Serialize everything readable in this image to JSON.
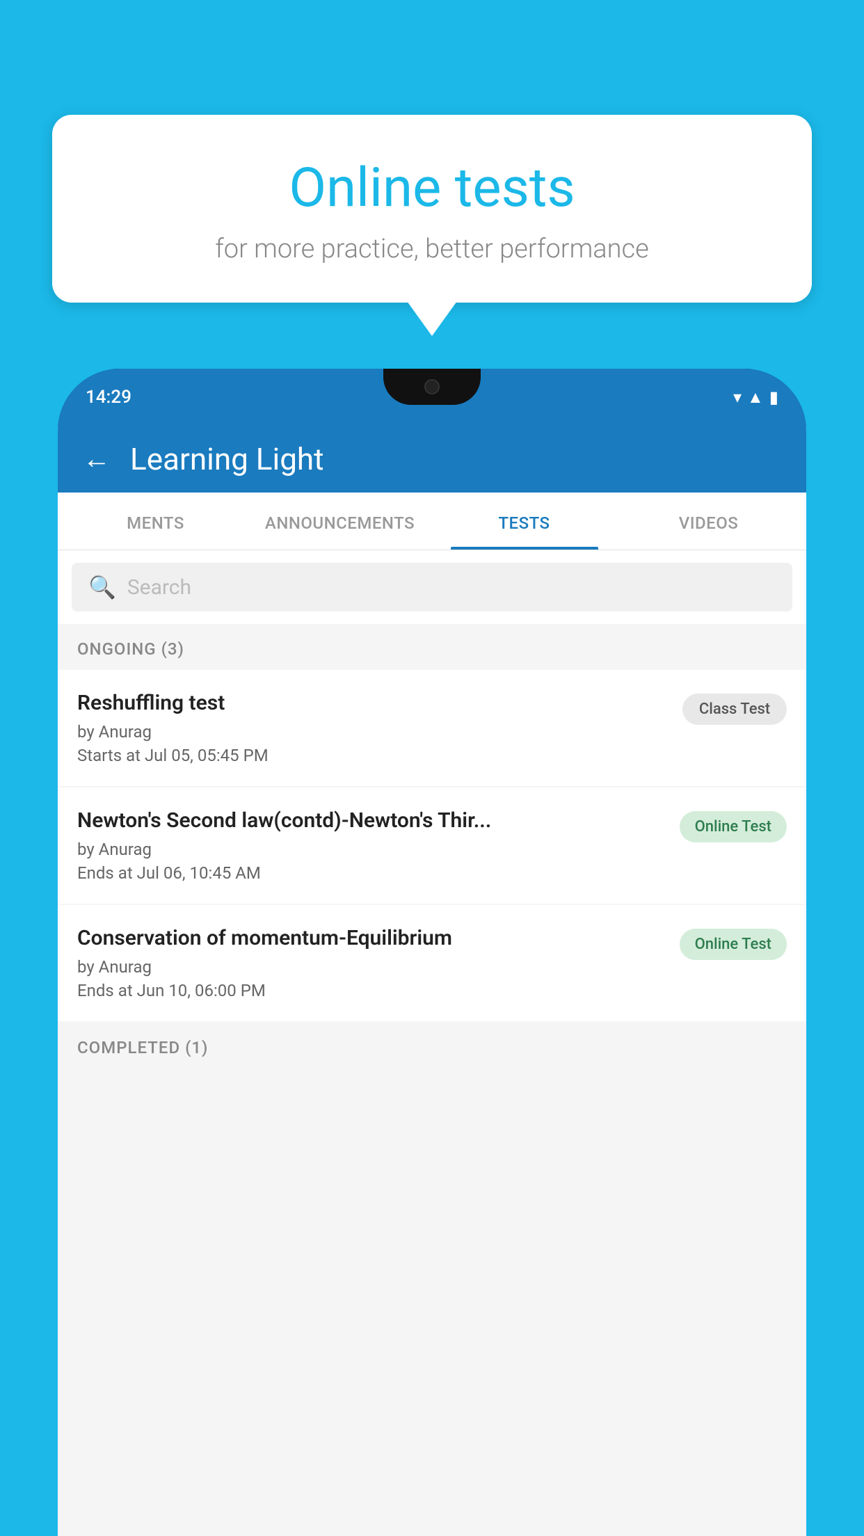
{
  "background_color": "#1bb8e8",
  "bubble": {
    "title": "Online tests",
    "subtitle": "for more practice, better performance"
  },
  "phone": {
    "status_time": "14:29",
    "header": {
      "back_label": "←",
      "title": "Learning Light"
    },
    "tabs": [
      {
        "id": "ments",
        "label": "MENTS",
        "active": false
      },
      {
        "id": "announcements",
        "label": "ANNOUNCEMENTS",
        "active": false
      },
      {
        "id": "tests",
        "label": "TESTS",
        "active": true
      },
      {
        "id": "videos",
        "label": "VIDEOS",
        "active": false
      }
    ],
    "search": {
      "placeholder": "Search"
    },
    "ongoing_section": {
      "label": "ONGOING (3)",
      "items": [
        {
          "id": "test-1",
          "name": "Reshuffling test",
          "author": "by Anurag",
          "date_label": "Starts at",
          "date": "Jul 05, 05:45 PM",
          "badge": "Class Test",
          "badge_type": "class"
        },
        {
          "id": "test-2",
          "name": "Newton's Second law(contd)-Newton's Thir...",
          "author": "by Anurag",
          "date_label": "Ends at",
          "date": "Jul 06, 10:45 AM",
          "badge": "Online Test",
          "badge_type": "online"
        },
        {
          "id": "test-3",
          "name": "Conservation of momentum-Equilibrium",
          "author": "by Anurag",
          "date_label": "Ends at",
          "date": "Jun 10, 06:00 PM",
          "badge": "Online Test",
          "badge_type": "online"
        }
      ]
    },
    "completed_section": {
      "label": "COMPLETED (1)"
    }
  }
}
